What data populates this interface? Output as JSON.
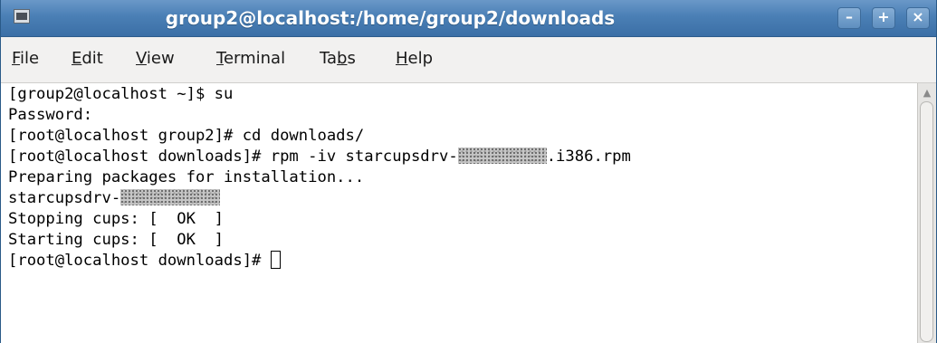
{
  "window": {
    "title": "group2@localhost:/home/group2/downloads",
    "minimize": "–",
    "maximize": "+",
    "close": "×"
  },
  "menu": [
    {
      "pre": "",
      "key": "F",
      "post": "ile"
    },
    {
      "pre": "",
      "key": "E",
      "post": "dit"
    },
    {
      "pre": "",
      "key": "V",
      "post": "iew"
    },
    {
      "pre": "",
      "key": "T",
      "post": "erminal"
    },
    {
      "pre": "Ta",
      "key": "b",
      "post": "s"
    },
    {
      "pre": "",
      "key": "H",
      "post": "elp"
    }
  ],
  "terminal": {
    "lines": [
      {
        "text": "[group2@localhost ~]$ su"
      },
      {
        "text": "Password:"
      },
      {
        "text": "[root@localhost group2]# cd downloads/"
      },
      {
        "text": "[root@localhost downloads]# rpm -iv starcupsdrv-",
        "after": ".i386.rpm"
      },
      {
        "text": "Preparing packages for installation..."
      },
      {
        "text": "starcupsdrv-",
        "after": ""
      },
      {
        "text": "Stopping cups: [  OK  ]"
      },
      {
        "text": "Starting cups: [  OK  ]"
      },
      {
        "text": "[root@localhost downloads]# "
      }
    ]
  },
  "icons": {
    "window": "terminal-app-icon",
    "scroll_up": "scroll-up-arrow-icon"
  }
}
